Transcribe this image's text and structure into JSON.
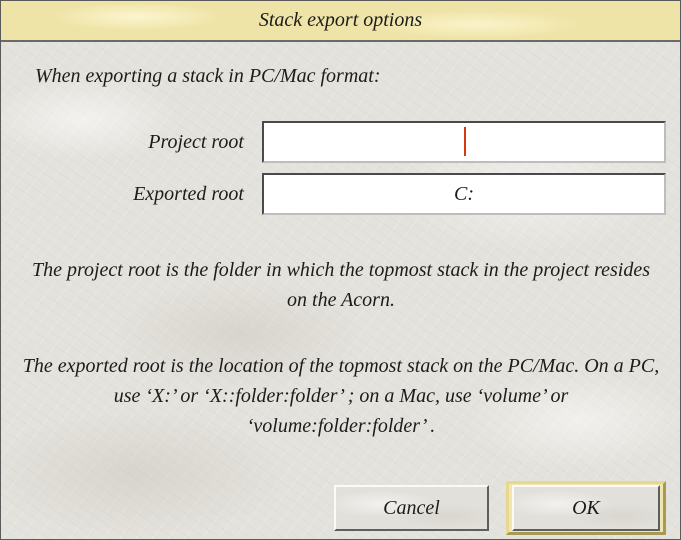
{
  "dialog": {
    "title": "Stack export options",
    "intro": "When exporting a stack in PC/Mac format:",
    "fields": {
      "project_root": {
        "label": "Project root",
        "value": ""
      },
      "exported_root": {
        "label": "Exported root",
        "value": "C:"
      }
    },
    "help": {
      "project_root_text": "The project root is the folder in which the topmost stack in the project resides on the Acorn.",
      "exported_root_text": "The exported root is the location of the topmost stack on the PC/Mac. On a PC, use ‘X:’ or ‘X::folder:folder’ ; on a Mac, use ‘volume’ or ‘volume:folder:folder’ ."
    },
    "buttons": {
      "cancel": "Cancel",
      "ok": "OK"
    }
  },
  "colors": {
    "title_bar": "#efe4a8",
    "dialog_background": "#e4e2dc",
    "caret": "#d43a10",
    "default_button_ring": "#e7d88e"
  }
}
